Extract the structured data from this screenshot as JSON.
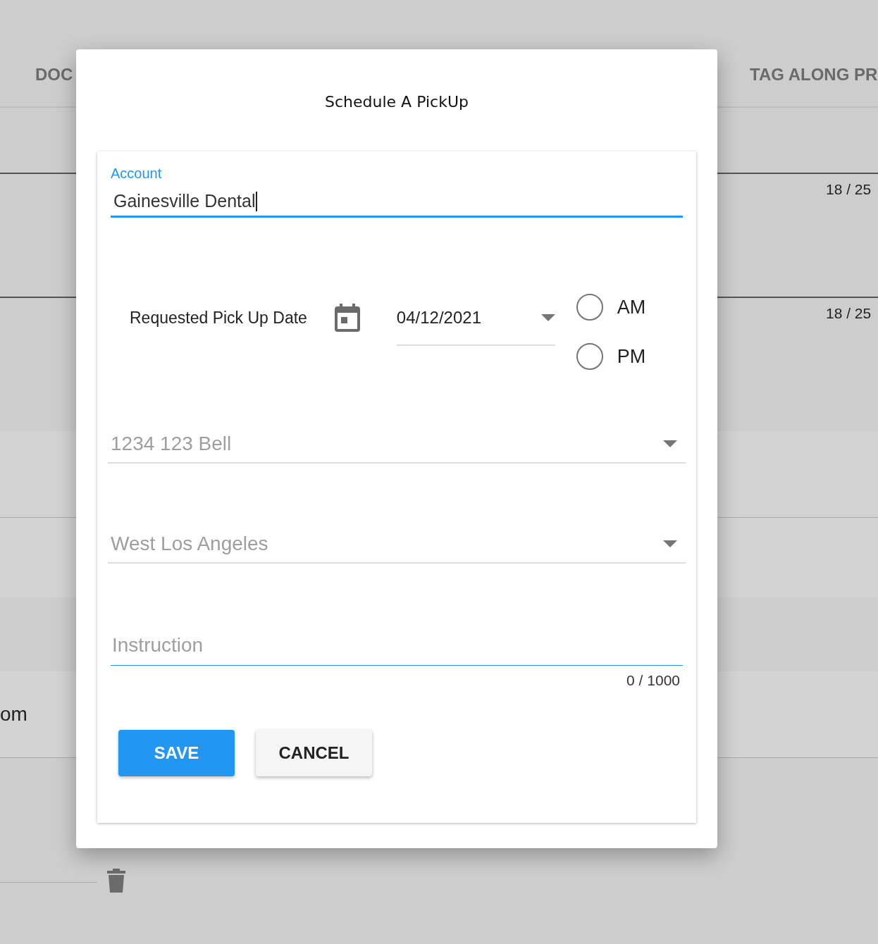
{
  "table": {
    "columns": [
      "DOC",
      "TAG ALONG PR"
    ],
    "rows": [
      {
        "column_2": ""
      },
      {
        "column_2": "18 / 25"
      },
      {
        "column_2": "18 / 25"
      },
      {
        "column_1": "om"
      }
    ]
  },
  "dialog": {
    "title": "Schedule A PickUp",
    "account": {
      "label": "Account",
      "value": "Gainesville Dental",
      "focused": true
    },
    "pickup_date": {
      "label": "Requested Pick Up Date",
      "value": "04/12/2021"
    },
    "time_options": [
      {
        "label": "AM",
        "selected": false
      },
      {
        "label": "PM",
        "selected": false
      }
    ],
    "selects": [
      {
        "placeholder": "1234 123 Bell"
      },
      {
        "placeholder": "West Los Angeles"
      }
    ],
    "instruction": {
      "placeholder": "Instruction",
      "counter": "0 / 1000"
    },
    "buttons": [
      {
        "label": "SAVE",
        "kind": "primary"
      },
      {
        "label": "CANCEL",
        "kind": "secondary"
      }
    ]
  }
}
